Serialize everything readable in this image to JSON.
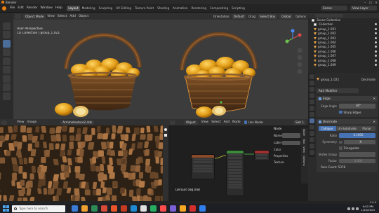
{
  "app": {
    "title": "Blender",
    "menus": [
      "File",
      "Edit",
      "Render",
      "Window",
      "Help"
    ],
    "workspaces": [
      "Layout",
      "Modeling",
      "Sculpting",
      "UV Editing",
      "Texture Paint",
      "Shading",
      "Animation",
      "Rendering",
      "Compositing",
      "Scripting"
    ],
    "active_workspace": "Layout",
    "scene": "Scene",
    "view_layer": "View Layer"
  },
  "viewport_toolbar": {
    "orientation_label": "Orientation:",
    "orientation_value": "Default",
    "drag_label": "Drag:",
    "drag_value": "Select Box",
    "pivot_value": "Global",
    "options_label": "Options"
  },
  "viewport_header": {
    "mode": "Object Mode",
    "menus": [
      "View",
      "Select",
      "Add",
      "Object"
    ]
  },
  "viewport_info": {
    "line1": "User Perspective",
    "line2": "(1) Collection | group_1.021"
  },
  "outliner": {
    "title": "Scene Collection",
    "collection": "Collection",
    "items": [
      "group_1.001",
      "group_1.002",
      "group_1.003",
      "group_1.004",
      "group_1.005",
      "group_1.006",
      "group_1.007",
      "group_1.008",
      "group_1.009"
    ]
  },
  "properties": {
    "object_name": "group_1.021",
    "modifier_name": "Decimate",
    "add_modifier": "Add Modifier",
    "edge_split": {
      "name": "Edge",
      "edge_angle_label": "Edge Angle",
      "edge_angle_value": "30°",
      "sharp_edges_label": "Sharp Edges"
    },
    "decimate": {
      "name": "Decimate",
      "modes": [
        "Collapse",
        "Un-Subdivide",
        "Planar"
      ],
      "active_mode": "Collapse",
      "ratio_label": "Ratio",
      "ratio_value": "0.1000",
      "symmetry_label": "Symmetry",
      "symmetry_axis": "X",
      "triangulate_label": "Triangulate",
      "vertex_group_label": "Vertex Group",
      "factor_label": "Factor",
      "factor_value": "0.000",
      "face_count": "Face Count: 5378"
    }
  },
  "image_editor": {
    "mode_menus": [
      "View",
      "Image"
    ],
    "image_name": "Armmetexture2.dds"
  },
  "node_editor": {
    "object_label": "Object",
    "menus": [
      "View",
      "Select",
      "Add",
      "Node"
    ],
    "use_nodes_label": "Use Nodes",
    "slot": "Slot 1",
    "material_name": "Default OBJ.048",
    "side_tabs": [
      "Node",
      "Tool",
      "View",
      "Options"
    ],
    "node_panel_labels": [
      "Node",
      "Name",
      "Label"
    ],
    "sidebar_items": [
      "Color",
      "Properties",
      "Texture"
    ],
    "right_object": "Default OB"
  },
  "status": {
    "version": "3.0.0"
  },
  "taskbar": {
    "search_placeholder": "Type here to search",
    "time": "9:02 PM",
    "date": "1/22/2023",
    "icon_colors": [
      "#3a7bd5",
      "#f0a030",
      "#2e8b57",
      "#d64a3a",
      "#e8552a",
      "#c23b22",
      "#1f8ad1",
      "#e0e0e0",
      "#27ae60",
      "#ff4d4d",
      "#7b5fd6",
      "#f5a623",
      "#d32f2f",
      "#2f80ed"
    ]
  },
  "colors": {
    "accent": "#4772b3",
    "orange": "#e8a34a",
    "viewport_bg": "#3c3c3c"
  }
}
